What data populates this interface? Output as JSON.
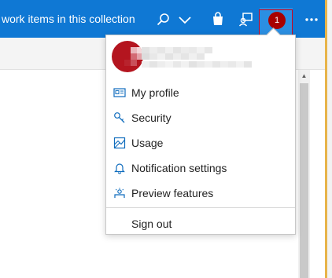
{
  "header": {
    "search_text": "work items in this collection",
    "notification_count": "1"
  },
  "profile_menu": {
    "items": [
      {
        "label": "My profile",
        "icon": "id-card-icon"
      },
      {
        "label": "Security",
        "icon": "key-icon"
      },
      {
        "label": "Usage",
        "icon": "usage-icon"
      },
      {
        "label": "Notification settings",
        "icon": "bell-icon"
      },
      {
        "label": "Preview features",
        "icon": "preview-features-icon"
      }
    ],
    "sign_out": "Sign out"
  },
  "colors": {
    "topbar": "#0f78d4",
    "active_user_tile": "#2b8fe2",
    "badge": "#a80000",
    "avatar": "#b4151f",
    "highlight_box": "#d0021b"
  }
}
